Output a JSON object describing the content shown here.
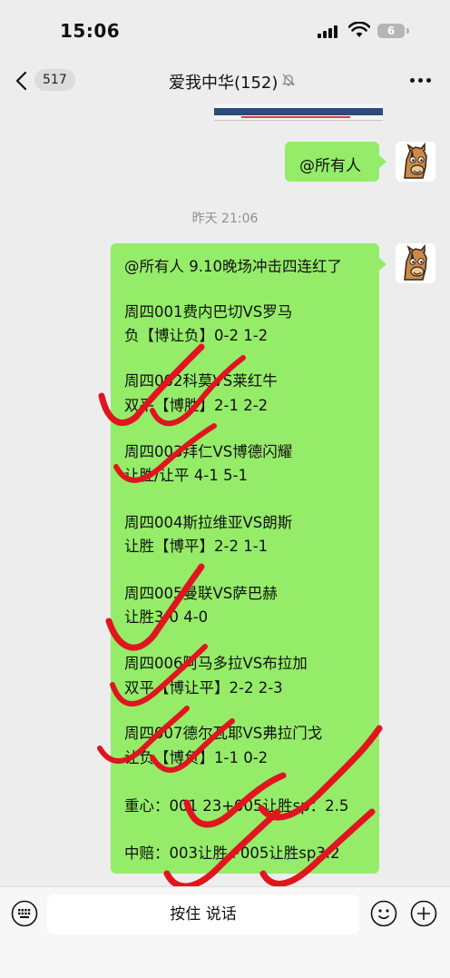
{
  "status_bar": {
    "time": "15:06",
    "battery": "6"
  },
  "header": {
    "back_count": "517",
    "title": "爱我中华(152)"
  },
  "messages": {
    "sent_mention": "@所有人",
    "timestamp": "昨天 21:06",
    "predictions": [
      "@所有人 9.10晚场冲击四连红了",
      "周四001费内巴切VS罗马",
      "负【博让负】0-2 1-2",
      "周四002科莫VS莱红牛",
      "双平【博胜】2-1 2-2",
      "周四003拜仁VS博德闪耀",
      "让胜/让平 4-1 5-1",
      "周四004斯拉维亚VS朗斯",
      "让胜【博平】2-2 1-1",
      "周四005曼联VS萨巴赫",
      "让胜3-0 4-0",
      "周四006阿马多拉VS布拉加",
      "双平【博让平】2-2 2-3",
      "周四007德尔瓦耶VS弗拉门戈",
      "让负【博负】1-1 0-2",
      "重心：001 23+005让胜sp：2.5",
      "中赔：003让胜+005让胜sp3.2"
    ]
  },
  "input_bar": {
    "voice_label": "按住 说话"
  },
  "colors": {
    "bubble": "#95ec69",
    "background": "#ededed",
    "scribble": "#e0151f"
  },
  "icons": [
    "signal-icon",
    "wifi-icon",
    "battery-icon",
    "back-icon",
    "mute-icon",
    "more-icon",
    "keyboard-icon",
    "emoji-icon",
    "plus-icon"
  ]
}
